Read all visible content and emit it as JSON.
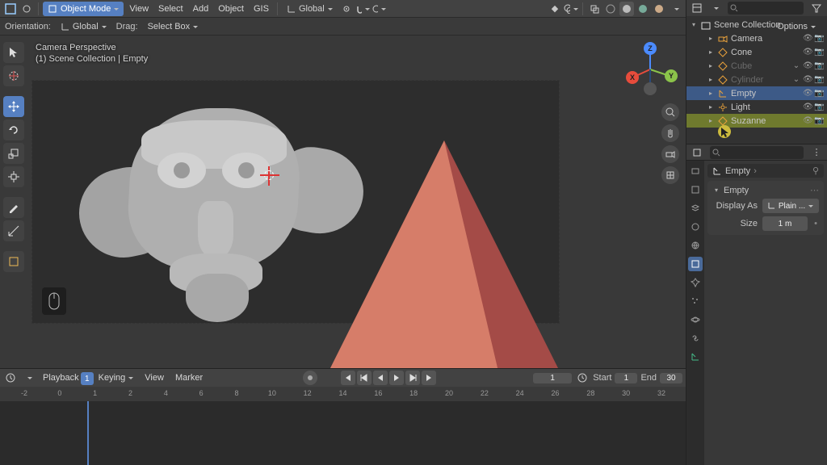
{
  "header": {
    "mode": "Object Mode",
    "menus": [
      "View",
      "Select",
      "Add",
      "Object",
      "GIS"
    ],
    "orient": "Global",
    "orientation_label": "Orientation:",
    "global_label": "Global",
    "drag_label": "Drag:",
    "drag": "Select Box",
    "options": "Options"
  },
  "viewport": {
    "title": "Camera Perspective",
    "subtitle": "(1) Scene Collection | Empty"
  },
  "axes": {
    "x": "X",
    "y": "Y",
    "z": "Z"
  },
  "timeline": {
    "menus": [
      "Playback",
      "Keying",
      "View",
      "Marker"
    ],
    "ticks": [
      "-2",
      "0",
      "1",
      "2",
      "4",
      "6",
      "8",
      "10",
      "12",
      "14",
      "16",
      "18",
      "20",
      "22",
      "24",
      "26",
      "28",
      "30",
      "32"
    ],
    "current": "1",
    "start_label": "Start",
    "start": "1",
    "end_label": "End",
    "end": "30",
    "frame_field": "1"
  },
  "outliner": {
    "root": "Scene Collection",
    "items": [
      {
        "name": "Camera",
        "icon": "cam",
        "ind": 1
      },
      {
        "name": "Cone",
        "icon": "mesh",
        "ind": 1
      },
      {
        "name": "Cube",
        "icon": "mesh",
        "ind": 1,
        "disabled": true
      },
      {
        "name": "Cylinder",
        "icon": "mesh",
        "ind": 1,
        "disabled": true
      },
      {
        "name": "Empty",
        "icon": "empty",
        "ind": 1,
        "sel": "sel"
      },
      {
        "name": "Light",
        "icon": "light",
        "ind": 1
      },
      {
        "name": "Suzanne",
        "icon": "mesh",
        "ind": 1,
        "sel": "sel2"
      }
    ]
  },
  "props": {
    "breadcrumb": "Empty",
    "panel_title": "Empty",
    "display_as_label": "Display As",
    "display_as": "Plain ...",
    "size_label": "Size",
    "size": "1 m"
  }
}
